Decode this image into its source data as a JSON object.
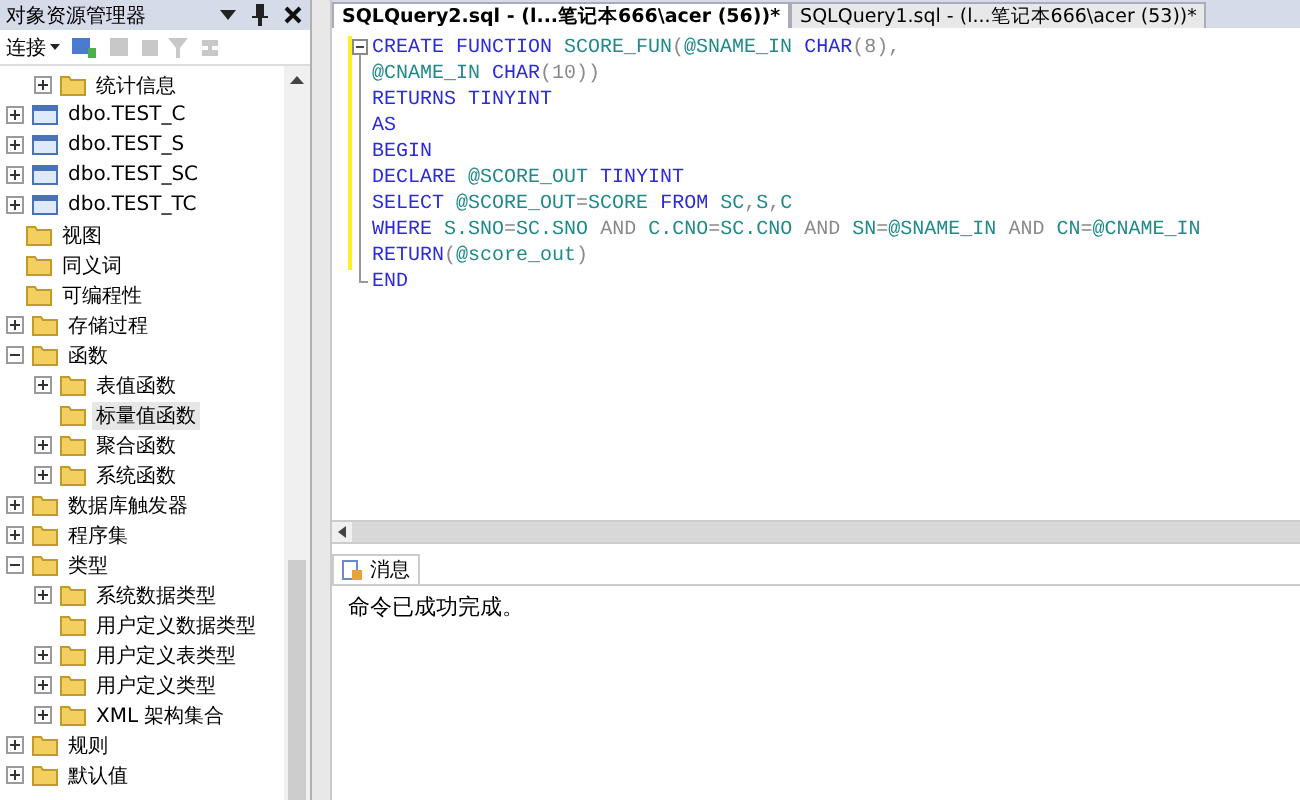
{
  "explorer": {
    "title": "对象资源管理器",
    "connect": "连接",
    "tree": [
      {
        "children": [
          {
            "children": [
              {
                "label": "统计信息",
                "kind": "folder",
                "expanded": false,
                "selected": false
              }
            ]
          },
          {
            "label": "dbo.TEST_C",
            "kind": "table",
            "expanded": false,
            "selected": false
          },
          {
            "label": "dbo.TEST_S",
            "kind": "table",
            "expanded": false,
            "selected": false
          },
          {
            "label": "dbo.TEST_SC",
            "kind": "table",
            "expanded": false,
            "selected": false
          },
          {
            "label": "dbo.TEST_TC",
            "kind": "table",
            "expanded": false,
            "selected": false
          }
        ]
      },
      {
        "label": "视图",
        "kind": "folder",
        "selected": false
      },
      {
        "label": "同义词",
        "kind": "folder",
        "selected": false
      },
      {
        "label": "可编程性",
        "kind": "folder",
        "selected": false,
        "children": [
          {
            "label": "存储过程",
            "kind": "folder",
            "expanded": false,
            "selected": false
          },
          {
            "label": "函数",
            "kind": "folder",
            "expanded": true,
            "selected": false,
            "children": [
              {
                "label": "表值函数",
                "kind": "folder",
                "expanded": false,
                "selected": false
              },
              {
                "label": "标量值函数",
                "kind": "folder",
                "selected": true
              },
              {
                "label": "聚合函数",
                "kind": "folder",
                "expanded": false,
                "selected": false
              },
              {
                "label": "系统函数",
                "kind": "folder",
                "expanded": false,
                "selected": false
              }
            ]
          },
          {
            "label": "数据库触发器",
            "kind": "folder",
            "expanded": false,
            "selected": false
          },
          {
            "label": "程序集",
            "kind": "folder",
            "expanded": false,
            "selected": false
          },
          {
            "label": "类型",
            "kind": "folder",
            "expanded": true,
            "selected": false,
            "children": [
              {
                "label": "系统数据类型",
                "kind": "folder",
                "expanded": false,
                "selected": false
              },
              {
                "label": "用户定义数据类型",
                "kind": "folder",
                "selected": false
              },
              {
                "label": "用户定义表类型",
                "kind": "folder",
                "expanded": false,
                "selected": false
              },
              {
                "label": "用户定义类型",
                "kind": "folder",
                "expanded": false,
                "selected": false
              },
              {
                "label": "XML 架构集合",
                "kind": "folder",
                "expanded": false,
                "selected": false
              }
            ]
          },
          {
            "label": "规则",
            "kind": "folder",
            "expanded": false,
            "selected": false
          },
          {
            "label": "默认值",
            "kind": "folder",
            "expanded": false,
            "selected": false
          }
        ]
      }
    ]
  },
  "tabs": [
    {
      "label": "SQLQuery2.sql - (l...笔记本666\\acer (56))*",
      "selected": true
    },
    {
      "label": "SQLQuery1.sql - (l...笔记本666\\acer (53))*",
      "selected": false
    }
  ],
  "code": [
    [
      {
        "t": "CREATE FUNCTION ",
        "kind": "keyword"
      },
      {
        "t": "SCORE_FUN",
        "kind": "name"
      },
      {
        "t": "(",
        "kind": "op"
      },
      {
        "t": "@SNAME_IN ",
        "kind": "name"
      },
      {
        "t": "CHAR",
        "kind": "keyword"
      },
      {
        "t": "(8),",
        "kind": "op"
      }
    ],
    [
      {
        "t": "@CNAME_IN ",
        "kind": "name"
      },
      {
        "t": "CHAR",
        "kind": "keyword"
      },
      {
        "t": "(10))",
        "kind": "op"
      }
    ],
    [
      {
        "t": "RETURNS TINYINT",
        "kind": "keyword"
      }
    ],
    [
      {
        "t": "AS",
        "kind": "keyword"
      }
    ],
    [
      {
        "t": "BEGIN",
        "kind": "keyword"
      }
    ],
    [
      {
        "t": "DECLARE ",
        "kind": "keyword"
      },
      {
        "t": "@SCORE_OUT ",
        "kind": "name"
      },
      {
        "t": "TINYINT",
        "kind": "keyword"
      }
    ],
    [
      {
        "t": "SELECT ",
        "kind": "keyword"
      },
      {
        "t": "@SCORE_OUT",
        "kind": "name"
      },
      {
        "t": "=",
        "kind": "op"
      },
      {
        "t": "SCORE ",
        "kind": "name"
      },
      {
        "t": "FROM ",
        "kind": "keyword"
      },
      {
        "t": "SC",
        "kind": "name"
      },
      {
        "t": ",",
        "kind": "op"
      },
      {
        "t": "S",
        "kind": "name"
      },
      {
        "t": ",",
        "kind": "op"
      },
      {
        "t": "C",
        "kind": "name"
      }
    ],
    [
      {
        "t": "WHERE ",
        "kind": "keyword"
      },
      {
        "t": "S.SNO",
        "kind": "name"
      },
      {
        "t": "=",
        "kind": "op"
      },
      {
        "t": "SC.SNO ",
        "kind": "name"
      },
      {
        "t": "AND ",
        "kind": "op"
      },
      {
        "t": "C.CNO",
        "kind": "name"
      },
      {
        "t": "=",
        "kind": "op"
      },
      {
        "t": "SC.CNO ",
        "kind": "name"
      },
      {
        "t": "AND ",
        "kind": "op"
      },
      {
        "t": "SN",
        "kind": "name"
      },
      {
        "t": "=",
        "kind": "op"
      },
      {
        "t": "@SNAME_IN ",
        "kind": "name"
      },
      {
        "t": "AND ",
        "kind": "op"
      },
      {
        "t": "CN",
        "kind": "name"
      },
      {
        "t": "=",
        "kind": "op"
      },
      {
        "t": "@CNAME_IN",
        "kind": "name"
      }
    ],
    [
      {
        "t": "RETURN",
        "kind": "keyword"
      },
      {
        "t": "(",
        "kind": "op"
      },
      {
        "t": "@score_out",
        "kind": "name"
      },
      {
        "t": ")",
        "kind": "op"
      }
    ],
    [
      {
        "t": "END",
        "kind": "keyword"
      }
    ]
  ],
  "results": {
    "tab": "消息",
    "message": "命令已成功完成。"
  }
}
